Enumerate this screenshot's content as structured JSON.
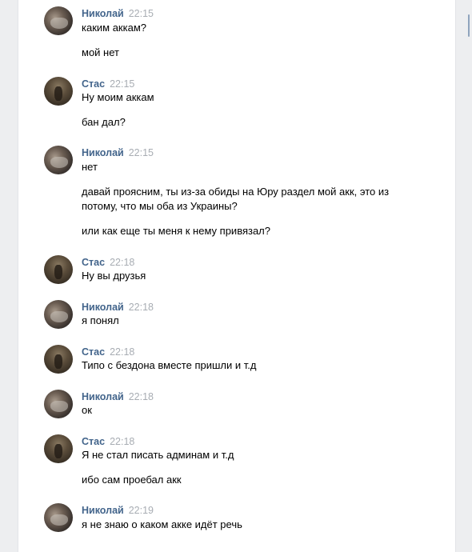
{
  "messages": [
    {
      "sender": "Николай",
      "time": "22:15",
      "avatar": "nikolai",
      "lines": [
        "каким аккам?",
        "мой нет"
      ]
    },
    {
      "sender": "Стас",
      "time": "22:15",
      "avatar": "stas",
      "lines": [
        "Ну моим аккам",
        "бан дал?"
      ]
    },
    {
      "sender": "Николай",
      "time": "22:15",
      "avatar": "nikolai",
      "lines": [
        "нет",
        "давай проясним, ты из-за обиды на Юру раздел мой акк, это из потому, что мы оба из Украины?",
        "или как еще ты меня к нему привязал?"
      ]
    },
    {
      "sender": "Стас",
      "time": "22:18",
      "avatar": "stas",
      "lines": [
        "Ну вы друзья"
      ]
    },
    {
      "sender": "Николай",
      "time": "22:18",
      "avatar": "nikolai",
      "lines": [
        "я понял"
      ]
    },
    {
      "sender": "Стас",
      "time": "22:18",
      "avatar": "stas",
      "lines": [
        "Типо с бездона вместе пришли и т.д"
      ]
    },
    {
      "sender": "Николай",
      "time": "22:18",
      "avatar": "nikolai",
      "lines": [
        "ок"
      ]
    },
    {
      "sender": "Стас",
      "time": "22:18",
      "avatar": "stas",
      "lines": [
        "Я не стал писать админам и т.д",
        "ибо сам проебал акк"
      ]
    },
    {
      "sender": "Николай",
      "time": "22:19",
      "avatar": "nikolai",
      "lines": [
        "я не знаю о каком акке идёт речь"
      ]
    }
  ]
}
